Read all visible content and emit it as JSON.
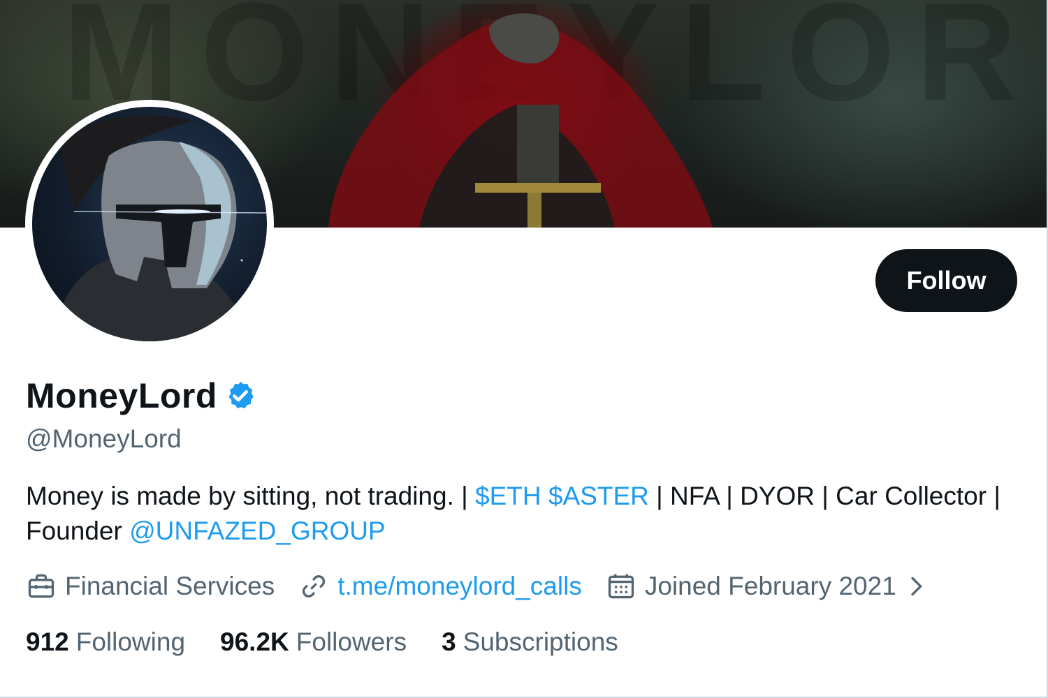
{
  "banner": {
    "watermark": "MONEYLORD"
  },
  "profile": {
    "display_name": "MoneyLord",
    "handle": "@MoneyLord",
    "verified_icon": "verified-badge-icon",
    "follow_label": "Follow"
  },
  "bio": {
    "text1": "Money is made by sitting, not trading. | ",
    "cashtags": "$ETH $ASTER",
    "text2": " | NFA | DYOR | Car Collector | Founder ",
    "mention": "@UNFAZED_GROUP"
  },
  "meta": {
    "category": "Financial Services",
    "link": "t.me/moneylord_calls",
    "joined": "Joined February 2021"
  },
  "stats": {
    "following_count": "912",
    "following_label": "Following",
    "followers_count": "96.2K",
    "followers_label": "Followers",
    "subscriptions_count": "3",
    "subscriptions_label": "Subscriptions"
  },
  "colors": {
    "link": "#1d9bf0",
    "text_primary": "#0f1419",
    "text_secondary": "#536471",
    "button_bg": "#0f1419"
  }
}
